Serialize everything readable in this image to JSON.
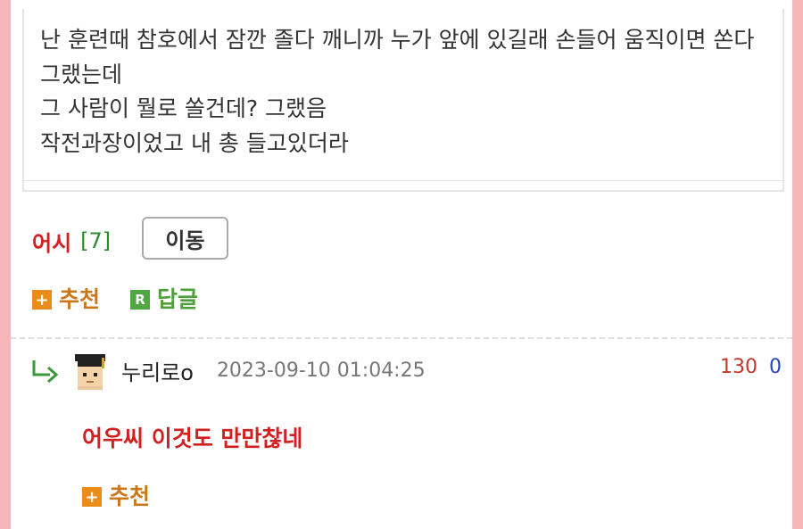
{
  "post": {
    "body": "난 훈련때 참호에서 잠깐 졸다 깨니까 누가 앞에 있길래 손들어 움직이면 쏜다 그랬는데\n그 사람이 뭘로 쏠건데? 그랬음\n작전과장이었고 내 총 들고있더라"
  },
  "comment_head": {
    "author": "어시",
    "count": "[7]",
    "move_button": "이동"
  },
  "actions": {
    "recommend": "추천",
    "reply": "답글",
    "plus_glyph": "+",
    "reply_glyph": "R"
  },
  "reply": {
    "nickname": "누리로o",
    "datetime": "2023-09-10 01:04:25",
    "upvotes": "130",
    "downvotes": "0",
    "text": "어우씨 이것도 만만찮네",
    "recommend": "추천"
  },
  "colors": {
    "background_frame": "#f6b6b8",
    "author_red": "#d21f1f",
    "count_green": "#2d8b2d",
    "recommend_orange": "#e98c1a",
    "reply_green": "#4fa83f"
  },
  "icons": {
    "reply_arrow": "reply-arrow-icon",
    "avatar": "graduate-avatar-icon"
  }
}
